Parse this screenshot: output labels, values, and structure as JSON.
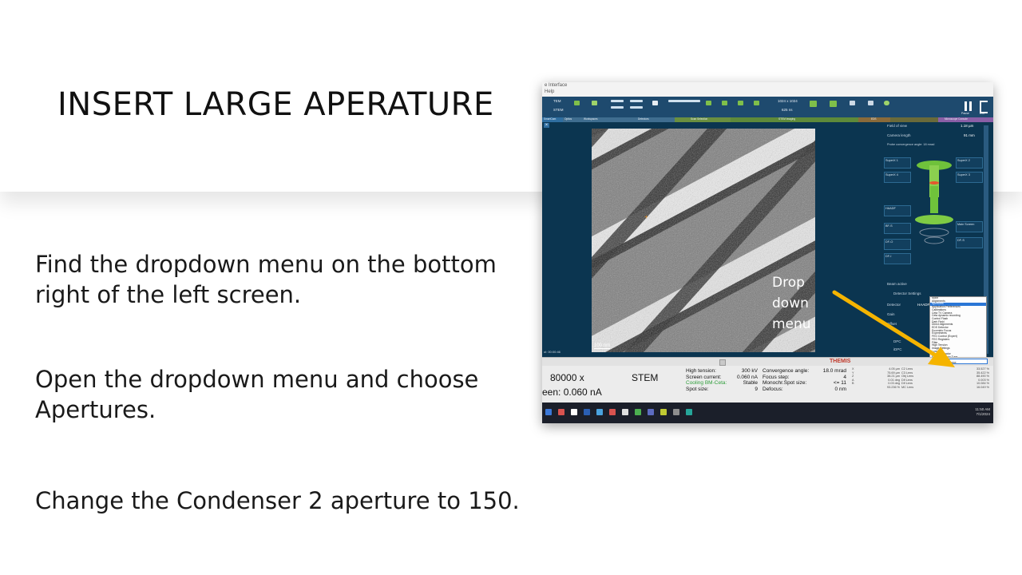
{
  "slide": {
    "title": "INSERT LARGE APERATURE",
    "paragraphs": [
      "Find the dropdown menu on the bottom right of the left screen.",
      "Open the dropdown menu and choose Apertures.",
      "Change the Condenser 2 aperture to 150."
    ],
    "annotation": {
      "lines": [
        "Drop",
        "down",
        "menu"
      ],
      "arrow_color": "#f5b400"
    }
  },
  "screenshot": {
    "window_title": "e Interface",
    "menu": "Help",
    "toolbar": {
      "mode_tem": "TEM",
      "mode_stem": "STEM",
      "frame": "1024 x 1024",
      "dwell": "625 ns",
      "pause_label": "Pause",
      "exit_label": "Exit"
    },
    "tabs": [
      "SmartCam",
      "Optics",
      "Workspaces",
      "Detectors",
      "Scan Selection",
      "STEM Imaging",
      "EDS",
      "Microscope Console"
    ],
    "image": {
      "scale_bar": "100 nm"
    },
    "right_panel": {
      "field_of_view_label": "Field of view",
      "field_of_view_value": "1.18 µm",
      "camera_length_label": "Camera length",
      "camera_length_value": "91 mm",
      "convergence_label": "Probe convergence angle: 18 mrad",
      "detector_boxes": [
        "SuperX 1",
        "SuperX 4",
        "SuperX 2",
        "SuperX 3",
        "HAADF",
        "BF-S",
        "DF-O",
        "DF-I",
        "Main Screen",
        "DF-S"
      ],
      "beam_label": "Beam active",
      "detector_settings": "Detector Settings",
      "detector_label": "Detector",
      "detector_value": "HAADF",
      "gain_label": "Gain",
      "offset_label": "Offset",
      "dpc_label": "DPC",
      "idpc_label": "iDPC"
    },
    "dropdown_items": [
      "None",
      "Alignments",
      "Apertures",
      "Application Preferences",
      "Calibrations",
      "Ceta TV Camera",
      "Cetа dynamic recording",
      "Control Flash",
      "Dark Field",
      "Direct Alignments",
      "EDS Detector",
      "Eucentric Focus",
      "Experiments",
      "FEG Control (Expert)",
      "FEG Registers",
      "Filter",
      "High Tension",
      "Image Settings",
      "Lorentz",
      "Monochromator",
      "Monochromator Tune",
      "Normalizations",
      "Piezo Stage",
      "Spectroscopy",
      "STEM Auto Tuning",
      "STEM Detector (User)",
      "STEM Imaging (Expert)",
      "Stigmator",
      "System Status",
      "Vacuum (Expert)",
      "Vacuum Overview",
      "Workspace Layout"
    ],
    "dropdown_highlight": "Apertures",
    "midbar": {
      "brand": "THEMIS",
      "selected": "None",
      "timestamp": "ol: 00:00:46"
    },
    "status": {
      "magnification": "80000 x",
      "mode": "STEM",
      "screen_current": "een:   0.060 nA",
      "rows": [
        {
          "label": "High tension:",
          "value": "300 kV",
          "label2": "Convergence angle:",
          "value2": "18.0 mrad"
        },
        {
          "label": "Screen current:",
          "value": "0.060 nA",
          "label2": "Focus step:",
          "value2": "4"
        },
        {
          "label": "Cooling BM-Ceta:",
          "value": "Stable",
          "label2": "Monochr.Spot size:",
          "value2": "<= 11"
        },
        {
          "label": "Spot size:",
          "value": "9",
          "label2": "Defocus:",
          "value2": "0 nm"
        }
      ],
      "stage": [
        {
          "axis": "X",
          "value": "4.05 µm",
          "lens": "C2 Lens",
          "pct": "33.527 %"
        },
        {
          "axis": "Y",
          "value": "75.69 µm",
          "lens": "C3 Lens",
          "pct": "35.422 %"
        },
        {
          "axis": "Z",
          "value": "38.21 µm",
          "lens": "Obj Lens",
          "pct": "88.490 %"
        },
        {
          "axis": "A",
          "value": "0.01 deg",
          "lens": "Dif Lens",
          "pct": "0.003 %"
        },
        {
          "axis": "B",
          "value": "0.03 deg",
          "lens": "Dif Lens",
          "pct": "10.084 %"
        },
        {
          "axis": "",
          "value": "93.236 %",
          "lens": "MC Lens",
          "pct": "16.049 %"
        }
      ]
    },
    "taskbar": {
      "time": "11:50 AM",
      "date": "7/1/2024"
    }
  }
}
